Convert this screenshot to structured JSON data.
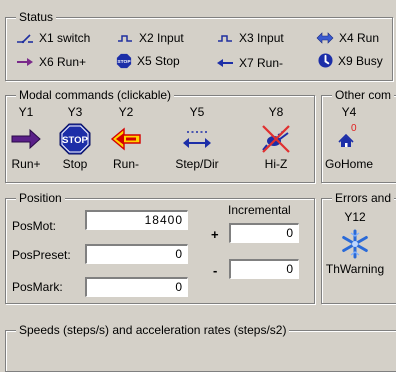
{
  "status": {
    "title": "Status",
    "items": [
      {
        "label": "X1 switch",
        "icon": "switch-icon"
      },
      {
        "label": "X2 Input",
        "icon": "input-icon"
      },
      {
        "label": "X3 Input",
        "icon": "input-icon"
      },
      {
        "label": "X4 Run",
        "icon": "run-icon"
      },
      {
        "label": "X6 Run+",
        "icon": "run-plus-icon"
      },
      {
        "label": "X5 Stop",
        "icon": "stop-icon"
      },
      {
        "label": "X7 Run-",
        "icon": "run-minus-icon"
      },
      {
        "label": "X9 Busy",
        "icon": "busy-icon"
      }
    ]
  },
  "modal": {
    "title": "Modal commands (clickable)",
    "buttons": [
      {
        "code": "Y1",
        "label": "Run+",
        "icon": "arrow-right-icon"
      },
      {
        "code": "Y3",
        "label": "Stop",
        "icon": "stop-sign-icon"
      },
      {
        "code": "Y2",
        "label": "Run-",
        "icon": "arrow-left-icon"
      },
      {
        "code": "Y5",
        "label": "Step/Dir",
        "icon": "step-dir-icon"
      },
      {
        "code": "Y8",
        "label": "Hi-Z",
        "icon": "hi-z-icon"
      }
    ]
  },
  "other": {
    "title": "Other com",
    "code": "Y4",
    "label": "GoHome",
    "badge": "0"
  },
  "position": {
    "title": "Position",
    "posmot_label": "PosMot:",
    "posmot_value": "18400",
    "pospreset_label": "PosPreset:",
    "pospreset_value": "0",
    "posmark_label": "PosMark:",
    "posmark_value": "0",
    "incremental_label": "Incremental",
    "plus": "+",
    "minus": "-",
    "inc_plus_value": "0",
    "inc_minus_value": "0"
  },
  "errors": {
    "title": "Errors and",
    "code": "Y12",
    "label": "ThWarning"
  },
  "speeds": {
    "title": "Speeds (steps/s) and acceleration rates (steps/s2)"
  }
}
